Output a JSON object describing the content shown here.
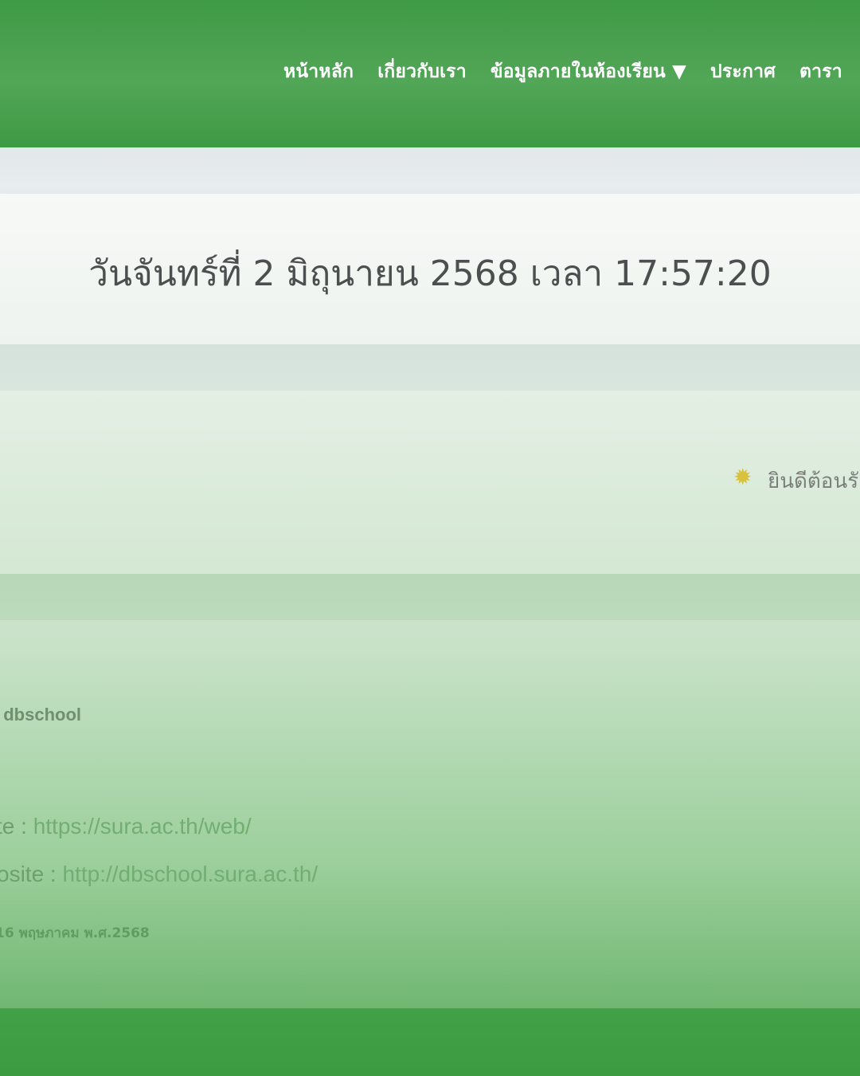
{
  "nav": {
    "items": [
      "หน้าหลัก",
      "เกี่ยวกับเรา",
      "ข้อมูลภายในห้องเรียน ▼",
      "ประกาศ",
      "ตารา"
    ]
  },
  "datetime": {
    "text": "วันจันทร์ที่ 2 มิถุนายน 2568 เวลา 17:57:20"
  },
  "welcome": {
    "icon": "sun-icon",
    "icon_glyph": "✹",
    "text": "ยินดีต้อนรั"
  },
  "footer": {
    "brand": "/ dbschool",
    "links": [
      {
        "label": "te : ",
        "url": "https://sura.ac.th/web/"
      },
      {
        "label": "osite : ",
        "url": "http://dbschool.sura.ac.th/"
      }
    ],
    "updated": "16 พฤษภาคม พ.ศ.2568"
  },
  "colors": {
    "header": "#4aa24f",
    "text_dark": "#4b4f4f",
    "link": "#72ad72",
    "sun": "#d8c23b"
  }
}
